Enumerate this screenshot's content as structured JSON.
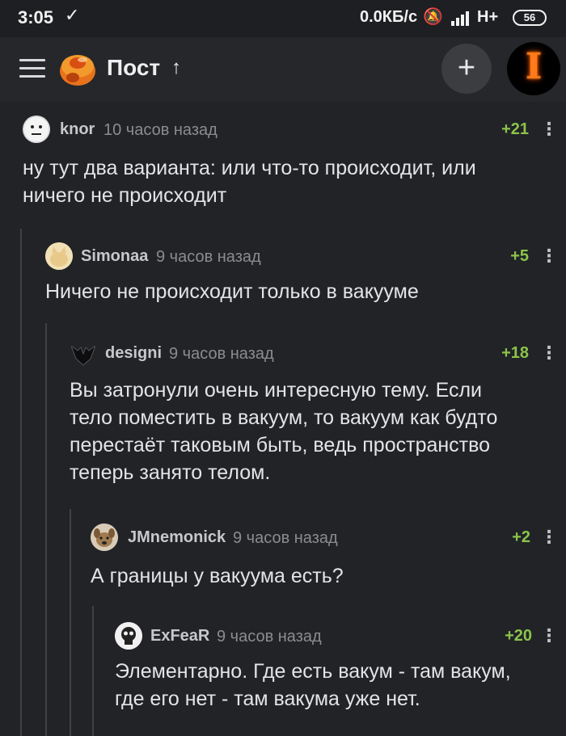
{
  "status_bar": {
    "time": "3:05",
    "download_icon": "check-icon",
    "speed": "0.0КБ/с",
    "network": "H+",
    "battery": "56"
  },
  "app_bar": {
    "title": "Пост",
    "title_arrow": "↑",
    "add_label": "+",
    "avatar_letter": "I"
  },
  "colors": {
    "background": "#212327",
    "rating": "#8bc34a",
    "author": "#c7c8ca",
    "time": "#8a8c90"
  },
  "comments": [
    {
      "author": "knor",
      "time": "10 часов назад",
      "rating": "+21",
      "text": "ну тут два варианта: или что-то происходит, или\nничего не происходит"
    },
    {
      "author": "Simonaa",
      "time": "9 часов назад",
      "rating": "+5",
      "text": "Ничего не происходит только в вакууме"
    },
    {
      "author": "designi",
      "time": "9 часов назад",
      "rating": "+18",
      "text": "Вы затронули очень интересную тему. Если\nтело поместить в вакуум, то вакуум как будто\nперестаёт таковым быть, ведь пространство\nтеперь занято телом."
    },
    {
      "author": "JMnemonick",
      "time": "9 часов назад",
      "rating": "+2",
      "text": "А границы у вакуума есть?"
    },
    {
      "author": "ExFeaR",
      "time": "9 часов назад",
      "rating": "+20",
      "text": "Элементарно. Где есть вакум - там вакум,\nгде его нет - там вакума уже нет."
    }
  ],
  "more_glyph": "⋮"
}
